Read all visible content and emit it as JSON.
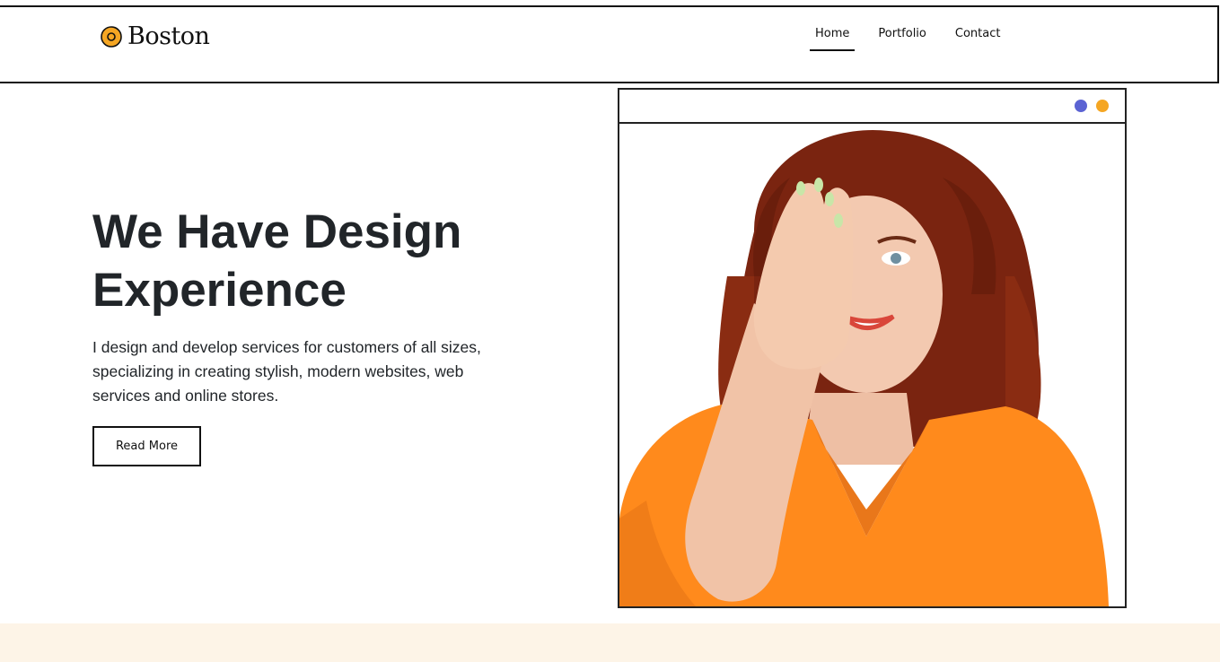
{
  "brand": {
    "name": "Boston",
    "icon": "circle-logo-icon",
    "accent_color": "#f5a623"
  },
  "nav": {
    "items": [
      {
        "label": "Home",
        "active": true
      },
      {
        "label": "Portfolio",
        "active": false
      },
      {
        "label": "Contact",
        "active": false
      }
    ]
  },
  "hero": {
    "title": "We Have Design Experience",
    "description": "I design and develop services for customers of all sizes, specializing in creating stylish, modern websites, web services and online stores.",
    "button_label": "Read More"
  },
  "frame": {
    "dots": [
      {
        "color": "#5b63d3"
      },
      {
        "color": "#f5a623"
      }
    ],
    "photo": "smiling-woman-covering-eye-photo",
    "photo_colors": {
      "shirt": "#ff8a1c",
      "hair": "#7a2410",
      "skin": "#f3c9b0"
    }
  },
  "colors": {
    "bottom_band": "#fdf4e7",
    "text": "#212529",
    "border": "#111111"
  }
}
